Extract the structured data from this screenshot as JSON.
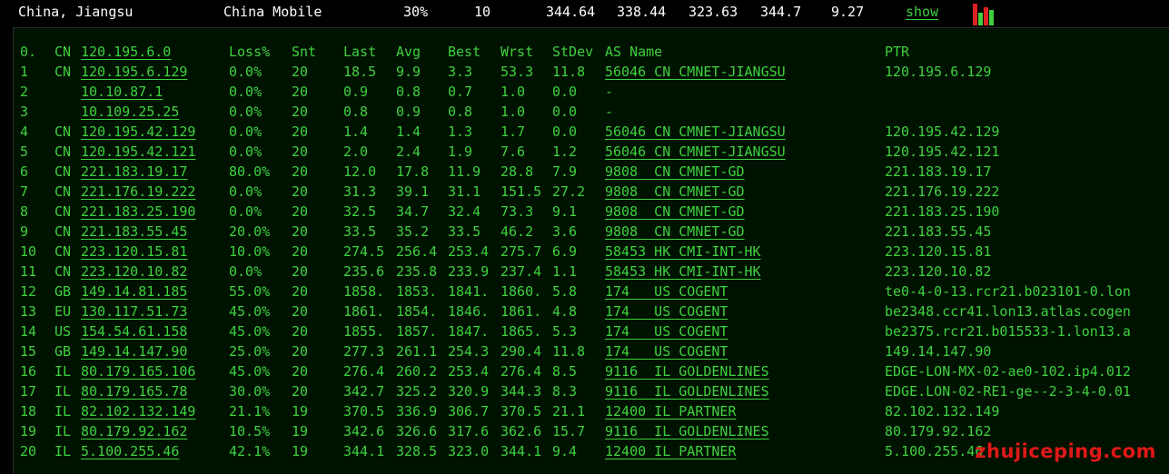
{
  "summary": {
    "location": "China, Jiangsu",
    "isp": "China Mobile",
    "loss": "30%",
    "count": "10",
    "v1": "344.64",
    "v2": "338.44",
    "v3": "323.63",
    "v4": "344.7",
    "v5": "9.27",
    "show_label": "show"
  },
  "colors": {
    "green": "#3fd03f",
    "bar_red": "#e02020",
    "watermark": "#e01818"
  },
  "header": {
    "idx": "0.",
    "cc": "CN",
    "host": "120.195.6.0",
    "loss": "Loss%",
    "snt": "Snt",
    "last": "Last",
    "avg": "Avg",
    "best": "Best",
    "wrst": "Wrst",
    "std": "StDev",
    "as": "AS Name",
    "ptr": "PTR"
  },
  "rows": [
    {
      "idx": "1",
      "cc": "CN",
      "host": "120.195.6.129",
      "loss": "0.0%",
      "snt": "20",
      "last": "18.5",
      "avg": "9.9",
      "best": "3.3",
      "wrst": "53.3",
      "std": "11.8",
      "as": "56046 CN CMNET-JIANGSU",
      "ptr": "120.195.6.129"
    },
    {
      "idx": "2",
      "cc": "",
      "host": "10.10.87.1",
      "loss": "0.0%",
      "snt": "20",
      "last": "0.9",
      "avg": "0.8",
      "best": "0.7",
      "wrst": "1.0",
      "std": "0.0",
      "as": "-",
      "ptr": ""
    },
    {
      "idx": "3",
      "cc": "",
      "host": "10.109.25.25",
      "loss": "0.0%",
      "snt": "20",
      "last": "0.8",
      "avg": "0.9",
      "best": "0.8",
      "wrst": "1.0",
      "std": "0.0",
      "as": "-",
      "ptr": ""
    },
    {
      "idx": "4",
      "cc": "CN",
      "host": "120.195.42.129",
      "loss": "0.0%",
      "snt": "20",
      "last": "1.4",
      "avg": "1.4",
      "best": "1.3",
      "wrst": "1.7",
      "std": "0.0",
      "as": "56046 CN CMNET-JIANGSU",
      "ptr": "120.195.42.129"
    },
    {
      "idx": "5",
      "cc": "CN",
      "host": "120.195.42.121",
      "loss": "0.0%",
      "snt": "20",
      "last": "2.0",
      "avg": "2.4",
      "best": "1.9",
      "wrst": "7.6",
      "std": "1.2",
      "as": "56046 CN CMNET-JIANGSU",
      "ptr": "120.195.42.121"
    },
    {
      "idx": "6",
      "cc": "CN",
      "host": "221.183.19.17",
      "loss": "80.0%",
      "snt": "20",
      "last": "12.0",
      "avg": "17.8",
      "best": "11.9",
      "wrst": "28.8",
      "std": "7.9",
      "as": "9808  CN CMNET-GD",
      "ptr": "221.183.19.17"
    },
    {
      "idx": "7",
      "cc": "CN",
      "host": "221.176.19.222",
      "loss": "0.0%",
      "snt": "20",
      "last": "31.3",
      "avg": "39.1",
      "best": "31.1",
      "wrst": "151.5",
      "std": "27.2",
      "as": "9808  CN CMNET-GD",
      "ptr": "221.176.19.222"
    },
    {
      "idx": "8",
      "cc": "CN",
      "host": "221.183.25.190",
      "loss": "0.0%",
      "snt": "20",
      "last": "32.5",
      "avg": "34.7",
      "best": "32.4",
      "wrst": "73.3",
      "std": "9.1",
      "as": "9808  CN CMNET-GD",
      "ptr": "221.183.25.190"
    },
    {
      "idx": "9",
      "cc": "CN",
      "host": "221.183.55.45",
      "loss": "20.0%",
      "snt": "20",
      "last": "33.5",
      "avg": "35.2",
      "best": "33.5",
      "wrst": "46.2",
      "std": "3.6",
      "as": "9808  CN CMNET-GD",
      "ptr": "221.183.55.45"
    },
    {
      "idx": "10",
      "cc": "CN",
      "host": "223.120.15.81",
      "loss": "10.0%",
      "snt": "20",
      "last": "274.5",
      "avg": "256.4",
      "best": "253.4",
      "wrst": "275.7",
      "std": "6.9",
      "as": "58453 HK CMI-INT-HK",
      "ptr": "223.120.15.81"
    },
    {
      "idx": "11",
      "cc": "CN",
      "host": "223.120.10.82",
      "loss": "0.0%",
      "snt": "20",
      "last": "235.6",
      "avg": "235.8",
      "best": "233.9",
      "wrst": "237.4",
      "std": "1.1",
      "as": "58453 HK CMI-INT-HK",
      "ptr": "223.120.10.82"
    },
    {
      "idx": "12",
      "cc": "GB",
      "host": "149.14.81.185",
      "loss": "55.0%",
      "snt": "20",
      "last": "1858.",
      "avg": "1853.",
      "best": "1841.",
      "wrst": "1860.",
      "std": "5.8",
      "as": "174   US COGENT",
      "ptr": "te0-4-0-13.rcr21.b023101-0.lon"
    },
    {
      "idx": "13",
      "cc": "EU",
      "host": "130.117.51.73",
      "loss": "45.0%",
      "snt": "20",
      "last": "1861.",
      "avg": "1854.",
      "best": "1846.",
      "wrst": "1861.",
      "std": "4.8",
      "as": "174   US COGENT",
      "ptr": "be2348.ccr41.lon13.atlas.cogen"
    },
    {
      "idx": "14",
      "cc": "US",
      "host": "154.54.61.158",
      "loss": "45.0%",
      "snt": "20",
      "last": "1855.",
      "avg": "1857.",
      "best": "1847.",
      "wrst": "1865.",
      "std": "5.3",
      "as": "174   US COGENT",
      "ptr": "be2375.rcr21.b015533-1.lon13.a"
    },
    {
      "idx": "15",
      "cc": "GB",
      "host": "149.14.147.90",
      "loss": "25.0%",
      "snt": "20",
      "last": "277.3",
      "avg": "261.1",
      "best": "254.3",
      "wrst": "290.4",
      "std": "11.8",
      "as": "174   US COGENT",
      "ptr": "149.14.147.90"
    },
    {
      "idx": "16",
      "cc": "IL",
      "host": "80.179.165.106",
      "loss": "45.0%",
      "snt": "20",
      "last": "276.4",
      "avg": "260.2",
      "best": "253.4",
      "wrst": "276.4",
      "std": "8.5",
      "as": "9116  IL GOLDENLINES",
      "ptr": "EDGE-LON-MX-02-ae0-102.ip4.012"
    },
    {
      "idx": "17",
      "cc": "IL",
      "host": "80.179.165.78",
      "loss": "30.0%",
      "snt": "20",
      "last": "342.7",
      "avg": "325.2",
      "best": "320.9",
      "wrst": "344.3",
      "std": "8.3",
      "as": "9116  IL GOLDENLINES",
      "ptr": "EDGE.LON-02-RE1-ge--2-3-4-0.01"
    },
    {
      "idx": "18",
      "cc": "IL",
      "host": "82.102.132.149",
      "loss": "21.1%",
      "snt": "19",
      "last": "370.5",
      "avg": "336.9",
      "best": "306.7",
      "wrst": "370.5",
      "std": "21.1",
      "as": "12400 IL PARTNER",
      "ptr": "82.102.132.149"
    },
    {
      "idx": "19",
      "cc": "IL",
      "host": "80.179.92.162",
      "loss": "10.5%",
      "snt": "19",
      "last": "342.6",
      "avg": "326.6",
      "best": "317.6",
      "wrst": "362.6",
      "std": "15.7",
      "as": "9116  IL GOLDENLINES",
      "ptr": "80.179.92.162"
    },
    {
      "idx": "20",
      "cc": "IL",
      "host": "5.100.255.46",
      "loss": "42.1%",
      "snt": "19",
      "last": "344.1",
      "avg": "328.5",
      "best": "323.0",
      "wrst": "344.1",
      "std": "9.4",
      "as": "12400 IL PARTNER",
      "ptr": "5.100.255.46"
    }
  ],
  "watermark": "zhujiceping.com"
}
